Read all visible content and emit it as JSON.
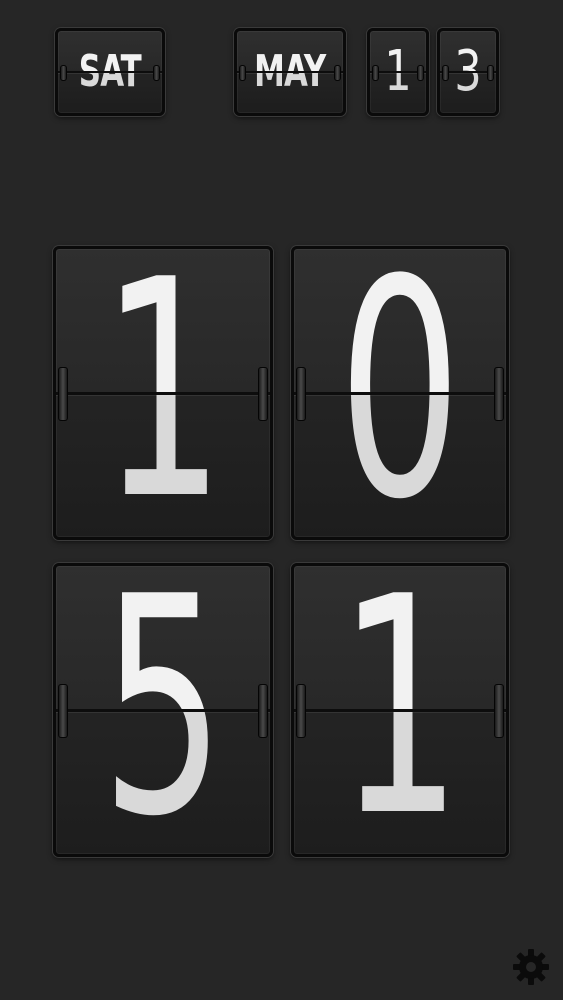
{
  "date": {
    "day_of_week": "SAT",
    "month": "MAY",
    "day_digit_1": "1",
    "day_digit_2": "3"
  },
  "time": {
    "hour_digit_1": "1",
    "hour_digit_2": "0",
    "minute_digit_1": "5",
    "minute_digit_2": "1"
  },
  "colors": {
    "background": "#262626",
    "card": "#2a2a2a",
    "digit": "#f2f2f2"
  },
  "icons": {
    "settings": "gear-icon"
  }
}
